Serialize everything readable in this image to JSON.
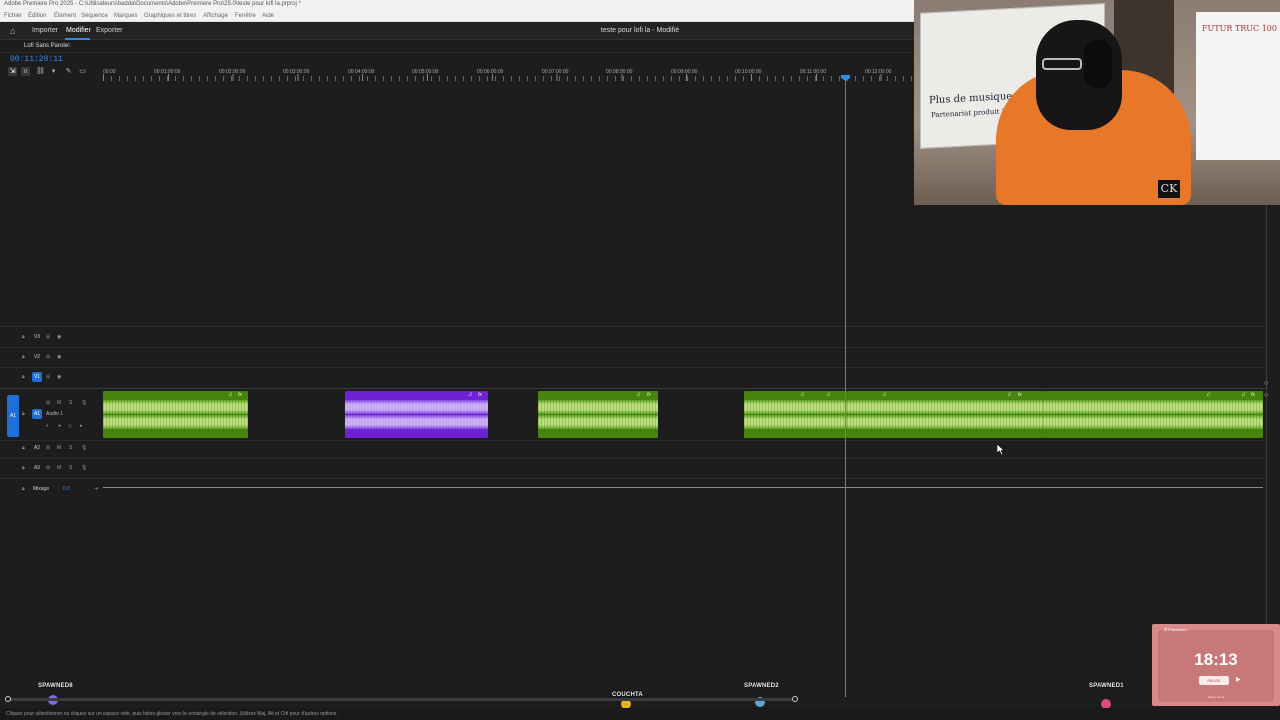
{
  "app": {
    "window_title": "Adobe Premiere Pro 2025 - C:\\Utilisateurs\\badda\\Documents\\Adobe\\Premiere Pro\\25.0\\teste pour lofi la.prproj *",
    "menu": [
      "Fichier",
      "Édition",
      "Élément",
      "Séquence",
      "Marques",
      "Graphiques et titres",
      "Affichage",
      "Fenêtre",
      "Aide"
    ],
    "workspace_tabs": [
      "Importer",
      "Modifier",
      "Exporter"
    ],
    "active_workspace": "Modifier",
    "doc_title": "teste pour lofi la - Modifié"
  },
  "sequence": {
    "tab_name": "Lofi Sans Parole",
    "close_glyph": "≡",
    "timecode": "00:11:28:11",
    "ruler_labels": [
      "00:00",
      "00:01:00:00",
      "00:02:00:00",
      "00:03:00:00",
      "00:04:00:00",
      "00:05:00:00",
      "00:06:00:00",
      "00:07:00:00",
      "00:08:00:00",
      "00:09:00:00",
      "00:10:00:00",
      "00:11:00:00",
      "00:12:00:00"
    ],
    "playhead_time": "00:11:28:11"
  },
  "tracks": {
    "video": [
      {
        "name": "V3"
      },
      {
        "name": "V2"
      },
      {
        "name": "V1",
        "selected": true
      }
    ],
    "audio": [
      {
        "name": "A1",
        "label": "Audio 1",
        "selected": true,
        "source": "A1"
      },
      {
        "name": "A2"
      },
      {
        "name": "A3"
      }
    ],
    "mix": {
      "label": "Mixage",
      "value": "0,0"
    }
  },
  "clips": [
    {
      "color": "green"
    },
    {
      "color": "purple"
    },
    {
      "color": "green"
    },
    {
      "color": "green"
    },
    {
      "color": "green"
    },
    {
      "color": "green"
    }
  ],
  "webcam": {
    "board_lines": [
      "Plus de musique j'en ai un au total",
      "Partenariat produit ?"
    ],
    "board2_text": "FUTUR TRUC 100",
    "logo": "CK"
  },
  "timer_widget": {
    "header": "⏱ Pomodoro",
    "time": "18:13",
    "button": "PAUSE",
    "play": "▶",
    "footer": "Pause focus"
  },
  "overlay": {
    "names": [
      "SPAWNED8",
      "COUCHTA",
      "SPAWNED2",
      "SPAWNED1"
    ],
    "colors": {
      "accent": "#2d8ceb",
      "clip_green": "#46830f",
      "clip_purple": "#6f22d4"
    }
  },
  "status": {
    "text": "Cliquez pour sélectionner ou cliquez sur un espace vide, puis faites glisser vers le rectangle de sélection. Utilisez Maj, Alt et Ctrl pour d'autres options."
  }
}
